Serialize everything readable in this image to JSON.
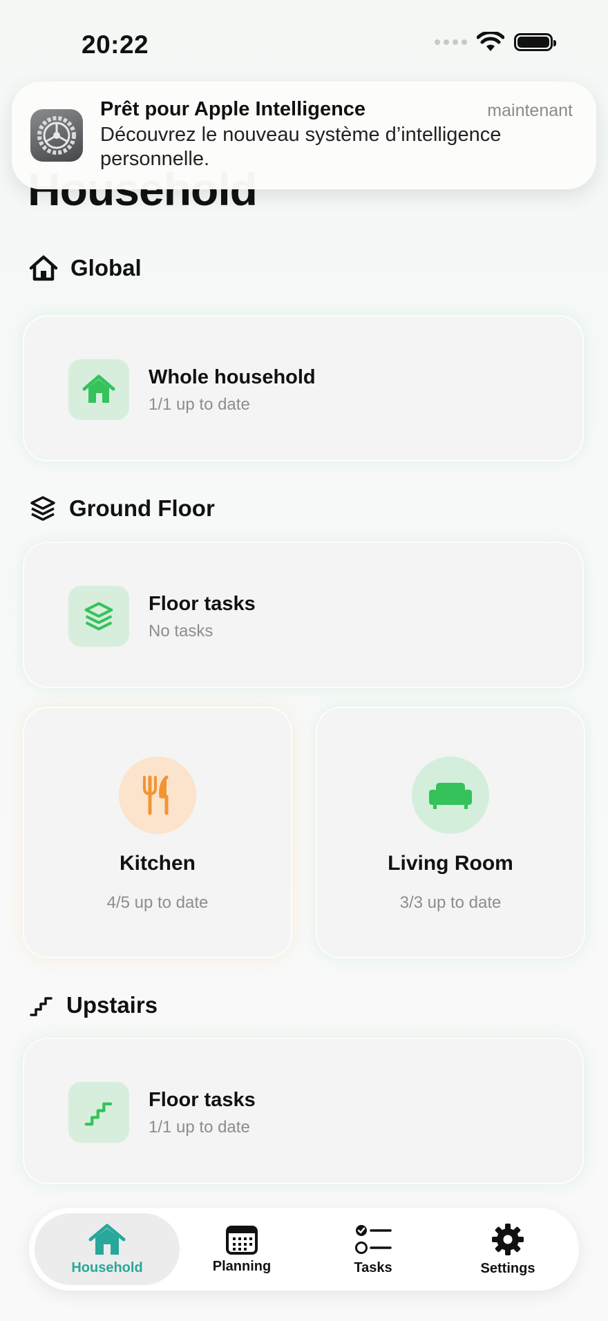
{
  "status": {
    "time": "20:22"
  },
  "notification": {
    "title": "Prêt pour Apple Intelligence",
    "time": "maintenant",
    "body": "Découvrez le nouveau système d’intelligence personnelle.",
    "icon": "settings-gear-icon"
  },
  "page": {
    "title": "Household"
  },
  "sections": {
    "global": {
      "label": "Global",
      "card": {
        "title": "Whole household",
        "subtitle": "1/1 up to date"
      }
    },
    "ground_floor": {
      "label": "Ground Floor",
      "card": {
        "title": "Floor tasks",
        "subtitle": "No tasks"
      },
      "rooms": [
        {
          "name": "Kitchen",
          "status": "4/5 up to date",
          "icon": "fork-knife-icon",
          "color": "#f39433"
        },
        {
          "name": "Living Room",
          "status": "3/3 up to date",
          "icon": "sofa-icon",
          "color": "#35c25b"
        }
      ]
    },
    "upstairs": {
      "label": "Upstairs",
      "card": {
        "title": "Floor tasks",
        "subtitle": "1/1 up to date"
      }
    }
  },
  "tabbar": {
    "tabs": [
      {
        "label": "Household",
        "icon": "house-icon",
        "active": true
      },
      {
        "label": "Planning",
        "icon": "calendar-icon"
      },
      {
        "label": "Tasks",
        "icon": "checklist-icon"
      },
      {
        "label": "Settings",
        "icon": "gear-icon"
      }
    ]
  },
  "colors": {
    "accent": "#27a89a",
    "green": "#35c25b",
    "orange": "#f39433"
  }
}
